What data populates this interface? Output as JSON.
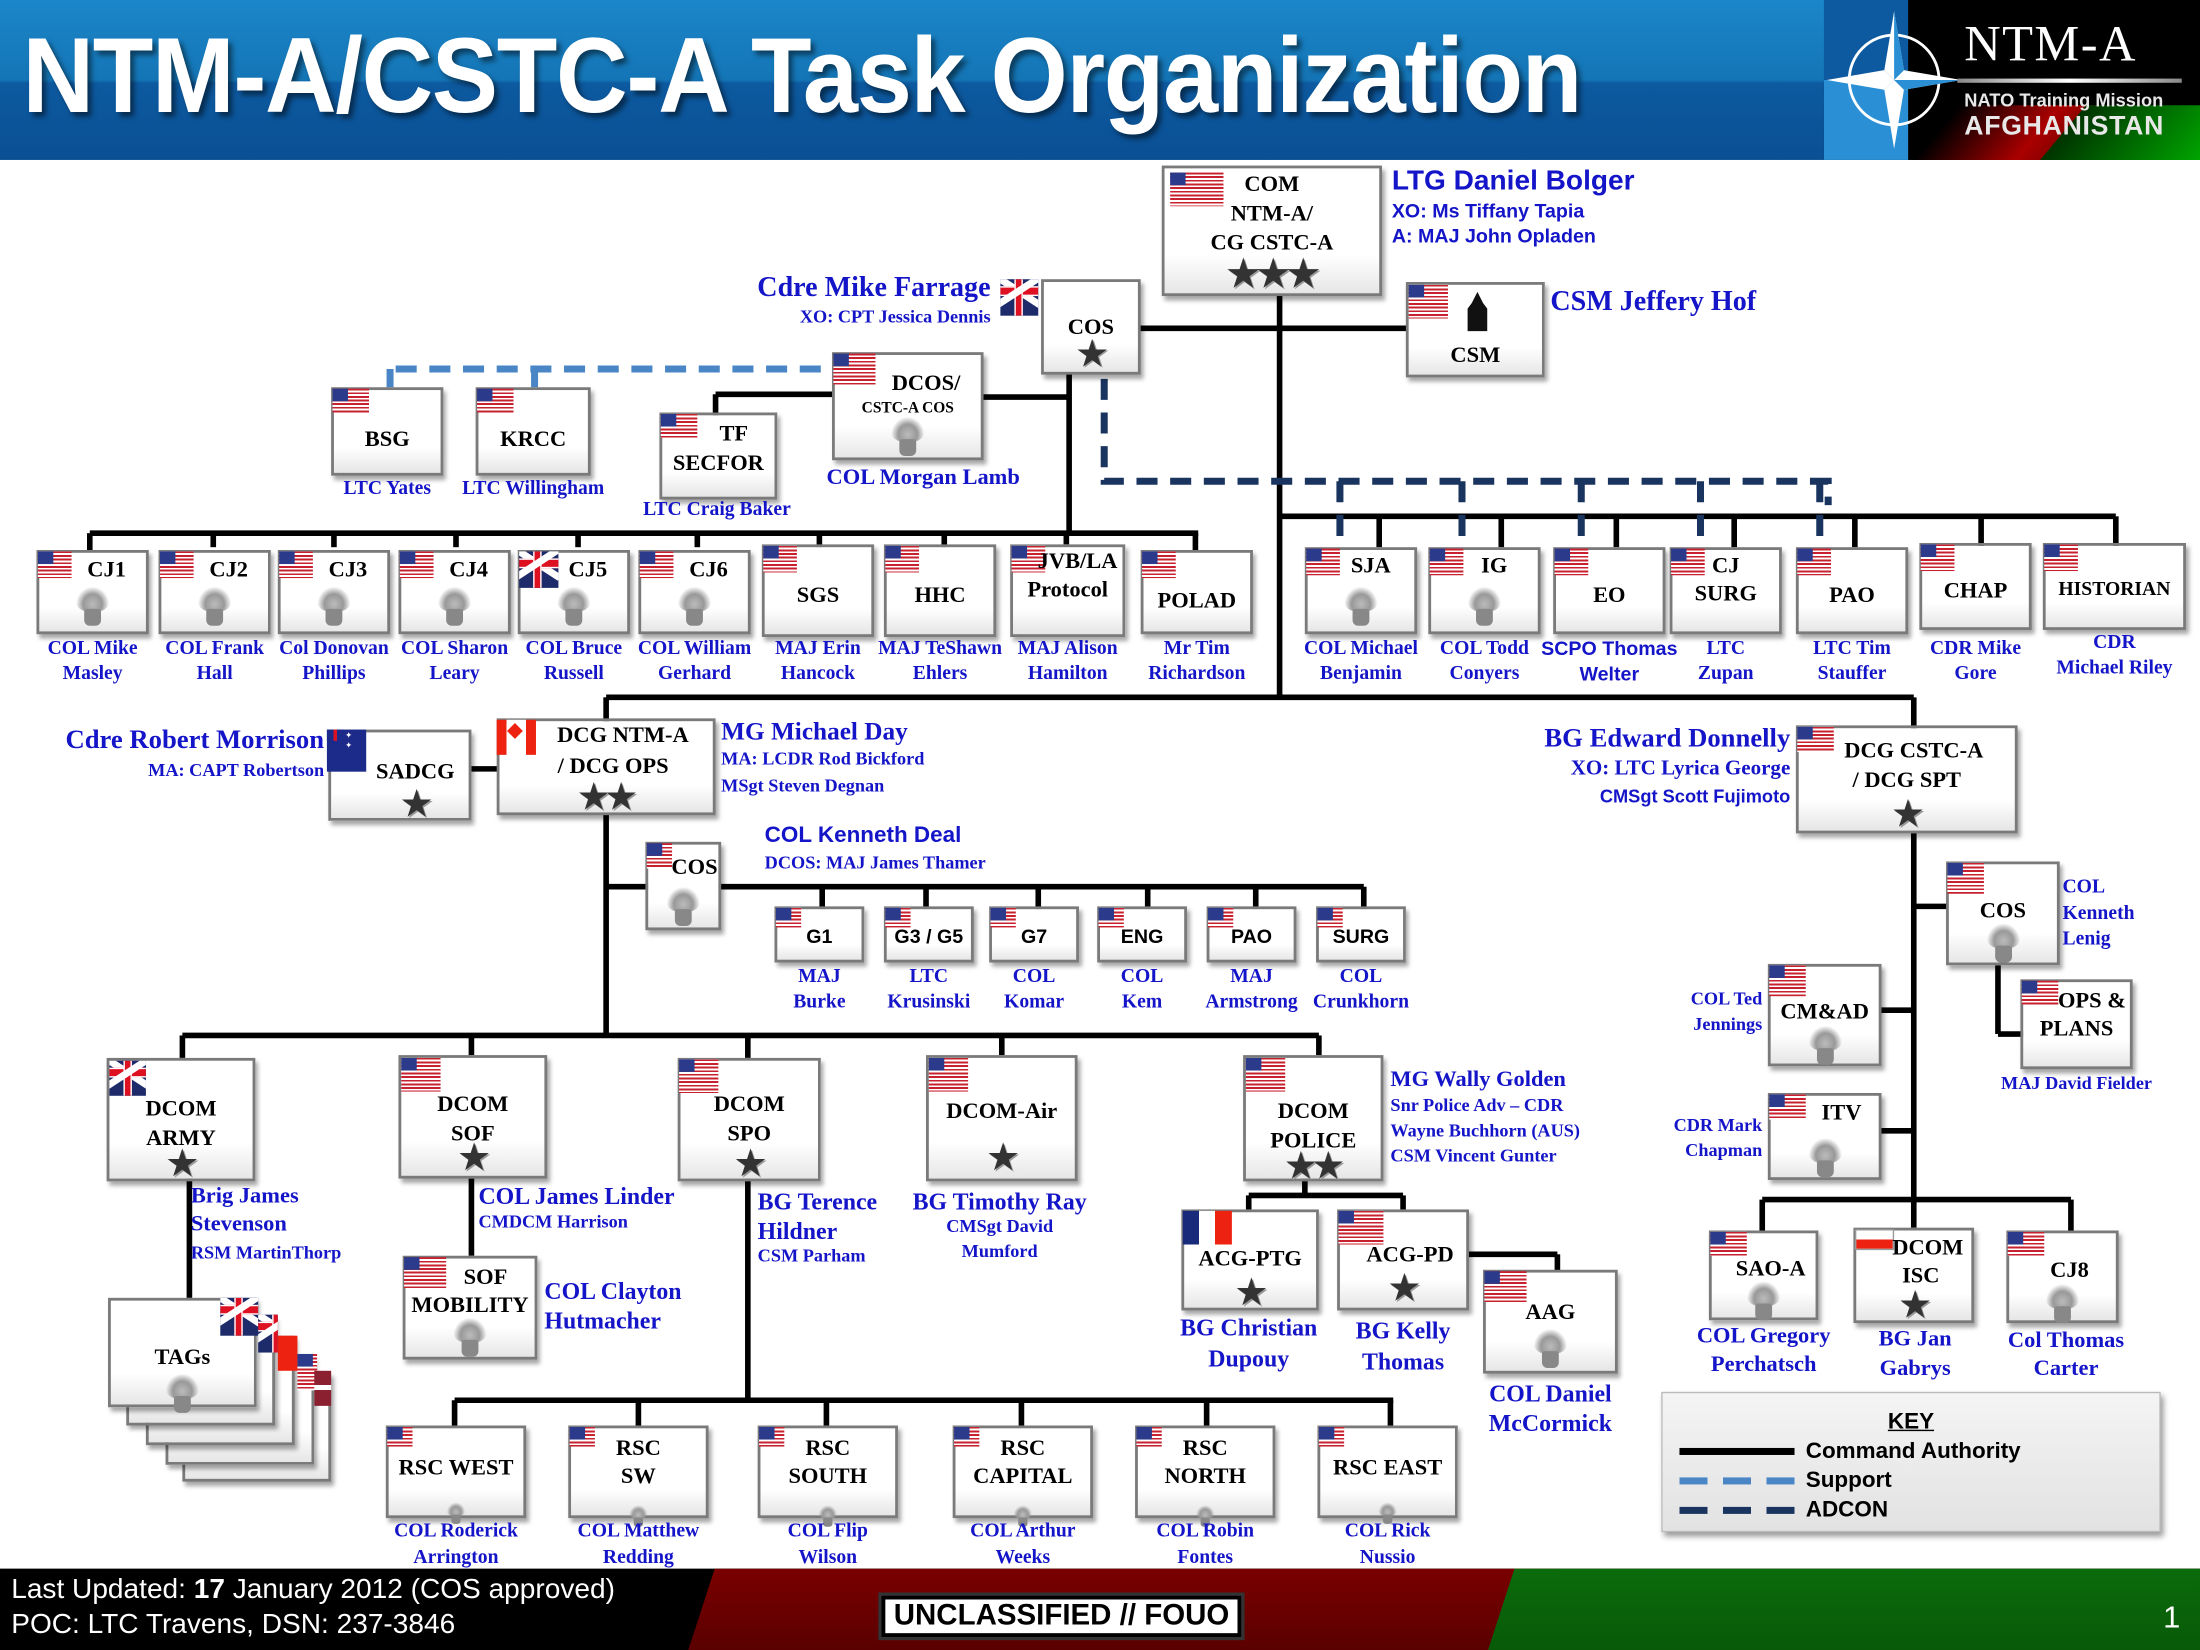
{
  "header": {
    "title": "NTM-A/CSTC-A Task Organization",
    "logo": {
      "name": "NTM-A",
      "line1": "NATO Training Mission",
      "line2": "AFGHANISTAN"
    }
  },
  "colors": {
    "header_blue": "#0d5aa0",
    "name_blue": "#1414c8",
    "support_line": "#4a86c6",
    "adcon_line": "#1a3460",
    "command_line": "#000000",
    "footer_red": "#6a0000",
    "footer_green": "#0b6b0b"
  },
  "top": {
    "com": {
      "lines": [
        "COM",
        "NTM-A/",
        "CG CSTC-A"
      ],
      "stars": "★★★",
      "flag": "US"
    },
    "com_person": {
      "name": "LTG Daniel Bolger",
      "xo": "XO:  Ms Tiffany Tapia",
      "aide": "A: MAJ John Opladen"
    },
    "cos": {
      "label": "COS",
      "stars": "★",
      "flag": "UK"
    },
    "cos_person": {
      "name": "Cdre Mike Farrage",
      "xo": "XO: CPT Jessica Dennis"
    },
    "csm": {
      "label": "CSM",
      "flag": "US"
    },
    "csm_person": {
      "name": "CSM Jeffery Hof"
    },
    "dcos": {
      "lines": [
        "DCOS/",
        "CSTC-A COS"
      ],
      "flag": "US",
      "person": "COL Morgan Lamb"
    },
    "bsg": {
      "label": "BSG",
      "flag": "US",
      "person": "LTC Yates"
    },
    "krcc": {
      "label": "KRCC",
      "flag": "US",
      "person": "LTC Willingham"
    },
    "tfsecfor": {
      "lines": [
        "TF",
        "SECFOR"
      ],
      "flag": "US",
      "person": "LTC Craig Baker"
    }
  },
  "staff_left": [
    {
      "label": "CJ1",
      "flag": "US",
      "person": [
        "COL Mike",
        "Masley"
      ]
    },
    {
      "label": "CJ2",
      "flag": "US",
      "person": [
        "COL Frank",
        "Hall"
      ]
    },
    {
      "label": "CJ3",
      "flag": "US",
      "person": [
        "Col Donovan",
        "Phillips"
      ]
    },
    {
      "label": "CJ4",
      "flag": "US",
      "person": [
        "COL Sharon",
        "Leary"
      ]
    },
    {
      "label": "CJ5",
      "flag": "UK",
      "person": [
        "COL Bruce",
        "Russell"
      ]
    },
    {
      "label": "CJ6",
      "flag": "US",
      "person": [
        "COL William",
        "Gerhard"
      ]
    },
    {
      "label": "SGS",
      "flag": "US",
      "person": [
        "MAJ Erin",
        "Hancock"
      ]
    },
    {
      "label": "HHC",
      "flag": "US",
      "person": [
        "MAJ TeShawn",
        "Ehlers"
      ]
    },
    {
      "label": "JVB/LA Protocol",
      "lines": [
        "JVB/LA",
        "Protocol"
      ],
      "flag": "US",
      "person": [
        "MAJ Alison",
        "Hamilton"
      ]
    },
    {
      "label": "POLAD",
      "flag": "US",
      "person": [
        "Mr Tim",
        "Richardson"
      ]
    }
  ],
  "staff_right": [
    {
      "label": "SJA",
      "flag": "US",
      "person": [
        "COL Michael",
        "Benjamin"
      ]
    },
    {
      "label": "IG",
      "flag": "US",
      "person": [
        "COL Todd",
        "Conyers"
      ]
    },
    {
      "label": "EO",
      "flag": "US",
      "person": [
        "SCPO Thomas",
        "Welter"
      ]
    },
    {
      "label": "CJ SURG",
      "lines": [
        "CJ",
        "SURG"
      ],
      "flag": "US",
      "person": [
        "LTC",
        "Zupan"
      ]
    },
    {
      "label": "PAO",
      "flag": "US",
      "person": [
        "LTC Tim",
        "Stauffer"
      ]
    },
    {
      "label": "CHAP",
      "flag": "US",
      "person": [
        "CDR Mike",
        "Gore"
      ]
    },
    {
      "label": "HISTORIAN",
      "flag": "US",
      "person": [
        "CDR",
        "Michael Riley"
      ]
    }
  ],
  "ops": {
    "sadcg": {
      "label": "SADCG",
      "stars": "★",
      "flag": "AU",
      "person": "Cdre Robert Morrison",
      "ma": "MA: CAPT Robertson"
    },
    "dcg": {
      "lines": [
        "DCG NTM-A",
        "/ DCG OPS"
      ],
      "stars": "★★",
      "flag": "CA",
      "person": "MG Michael Day",
      "ma": "MA: LCDR Rod Bickford",
      "nco": "MSgt Steven Degnan"
    },
    "cos": {
      "label": "COS",
      "flag": "US",
      "person": "COL Kenneth Deal",
      "dcos": "DCOS: MAJ James Thamer"
    },
    "gstaff": [
      {
        "label": "G1",
        "person": [
          "MAJ",
          "Burke"
        ]
      },
      {
        "label": "G3 / G5",
        "person": [
          "LTC",
          "Krusinski"
        ]
      },
      {
        "label": "G7",
        "person": [
          "COL",
          "Komar"
        ]
      },
      {
        "label": "ENG",
        "person": [
          "COL",
          "Kem"
        ]
      },
      {
        "label": "PAO",
        "person": [
          "MAJ",
          "Armstrong"
        ]
      },
      {
        "label": "SURG",
        "person": [
          "COL",
          "Crunkhorn"
        ]
      }
    ],
    "dcom_army": {
      "lines": [
        "DCOM",
        "ARMY"
      ],
      "stars": "★",
      "flag": "UK",
      "person": [
        "Brig James",
        "Stevenson"
      ],
      "nco": "RSM  MartinThorp"
    },
    "tags": {
      "label": "TAGs"
    },
    "dcom_sof": {
      "lines": [
        "DCOM",
        "SOF"
      ],
      "stars": "★",
      "flag": "US",
      "person": "COL James Linder",
      "nco": "CMDCM Harrison"
    },
    "sof_mobility": {
      "lines": [
        "SOF",
        "MOBILITY"
      ],
      "flag": "US",
      "person": [
        "COL Clayton",
        "Hutmacher"
      ]
    },
    "dcom_spo": {
      "lines": [
        "DCOM",
        "SPO"
      ],
      "stars": "★",
      "flag": "US",
      "person": [
        "BG Terence",
        "Hildner"
      ],
      "nco": "CSM  Parham"
    },
    "dcom_air": {
      "label": "DCOM-Air",
      "stars": "★",
      "flag": "US",
      "person": "BG Timothy Ray",
      "nco": [
        "CMSgt David",
        "Mumford"
      ]
    },
    "dcom_police": {
      "lines": [
        "DCOM",
        "POLICE"
      ],
      "stars": "★★",
      "flag": "US",
      "person": "MG Wally Golden",
      "adv": [
        "Snr Police Adv – CDR",
        "Wayne Buchhorn (AUS)"
      ],
      "nco": "CSM Vincent Gunter"
    },
    "acg_ptg": {
      "label": "ACG-PTG",
      "stars": "★",
      "flag": "FR",
      "person": [
        "BG Christian",
        "Dupouy"
      ]
    },
    "acg_pd": {
      "label": "ACG-PD",
      "stars": "★",
      "flag": "US",
      "person": [
        "BG Kelly",
        "Thomas"
      ]
    },
    "aag": {
      "label": "AAG",
      "flag": "US",
      "person": [
        "COL Daniel",
        "McCormick"
      ]
    },
    "rsc": [
      {
        "lines": [
          "RSC WEST"
        ],
        "person": [
          "COL Roderick",
          "Arrington"
        ]
      },
      {
        "lines": [
          "RSC",
          "SW"
        ],
        "person": [
          "COL Matthew",
          "Redding"
        ]
      },
      {
        "lines": [
          "RSC",
          "SOUTH"
        ],
        "person": [
          "COL Flip",
          "Wilson"
        ]
      },
      {
        "lines": [
          "RSC",
          "CAPITAL"
        ],
        "person": [
          "COL Arthur",
          "Weeks"
        ]
      },
      {
        "lines": [
          "RSC",
          "NORTH"
        ],
        "person": [
          "COL Robin",
          "Fontes"
        ]
      },
      {
        "lines": [
          "RSC EAST"
        ],
        "person": [
          "COL Rick",
          "Nussio"
        ]
      }
    ]
  },
  "spt": {
    "dcg": {
      "lines": [
        "DCG CSTC-A",
        "/ DCG SPT"
      ],
      "stars": "★",
      "flag": "US",
      "person": "BG Edward Donnelly",
      "xo": "XO: LTC Lyrica George",
      "nco": "CMSgt Scott Fujimoto"
    },
    "cos": {
      "label": "COS",
      "flag": "US",
      "person": [
        "COL",
        "Kenneth",
        "Lenig"
      ]
    },
    "ops_plans": {
      "lines": [
        "OPS &",
        "PLANS"
      ],
      "flag": "US",
      "person": "MAJ David Fielder"
    },
    "cmad": {
      "label": "CM&AD",
      "flag": "US",
      "person": [
        "COL Ted",
        "Jennings"
      ]
    },
    "itv": {
      "label": "ITV",
      "flag": "US",
      "person": [
        "CDR Mark",
        "Chapman"
      ]
    },
    "sao_a": {
      "label": "SAO-A",
      "flag": "US",
      "person": [
        "COL Gregory",
        "Perchatsch"
      ]
    },
    "dcom_isc": {
      "lines": [
        "DCOM",
        "ISC"
      ],
      "stars": "★",
      "flag": "PL",
      "person": [
        "BG Jan",
        "Gabrys"
      ]
    },
    "cj8": {
      "label": "CJ8",
      "flag": "US",
      "person": [
        "Col Thomas",
        "Carter"
      ]
    }
  },
  "key": {
    "title": "KEY",
    "items": [
      {
        "type": "command",
        "label": "Command Authority"
      },
      {
        "type": "support",
        "label": "Support"
      },
      {
        "type": "adcon",
        "label": "ADCON"
      }
    ]
  },
  "footer": {
    "updated_label": "Last Updated: ",
    "updated_date": "17",
    "updated_rest": " January 2012 (COS approved)",
    "poc": "POC: LTC Travens, DSN: 237-3846",
    "classification": "UNCLASSIFIED // FOUO",
    "page_number": "1"
  }
}
